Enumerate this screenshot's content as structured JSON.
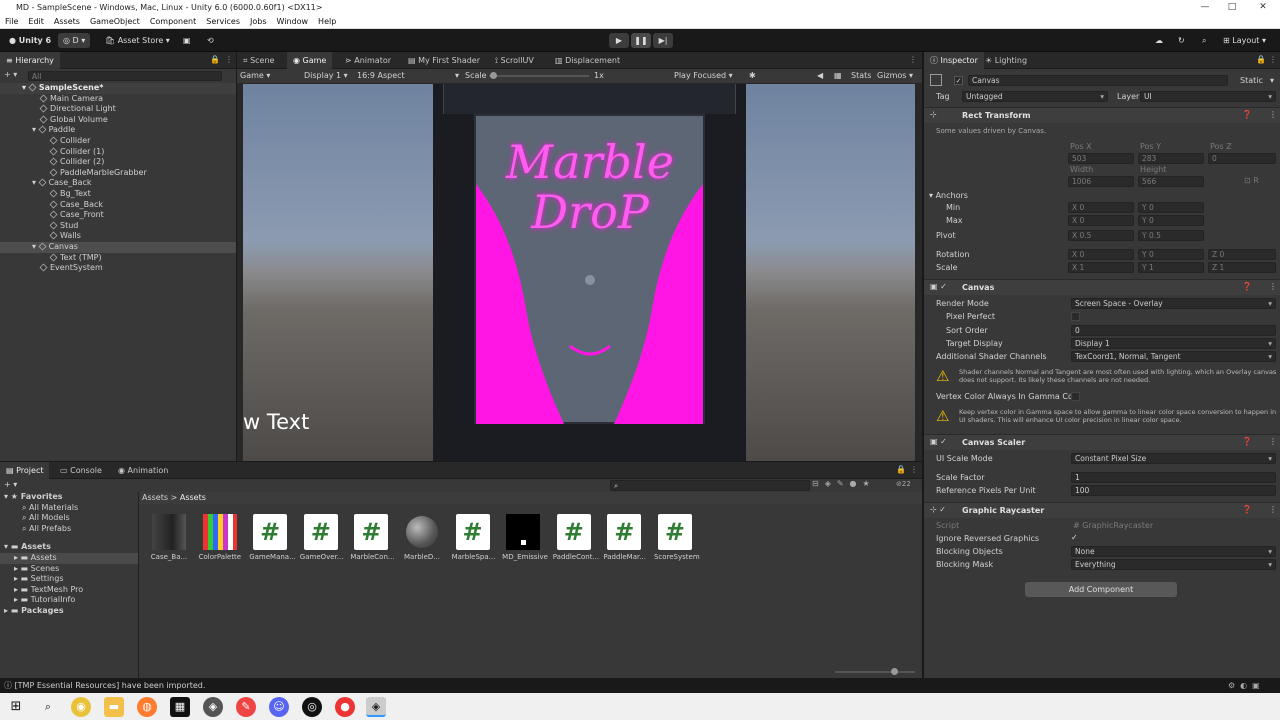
{
  "window": {
    "title": "MD - SampleScene - Windows, Mac, Linux - Unity 6.0 (6000.0.60f1) <DX11>"
  },
  "menu": [
    "File",
    "Edit",
    "Assets",
    "GameObject",
    "Component",
    "Services",
    "Jobs",
    "Window",
    "Help"
  ],
  "toolbar": {
    "account": "Unity 6",
    "collab": "D",
    "asset_store": "Asset Store",
    "layout": "Layout"
  },
  "scene_tabs": [
    "Scene",
    "Game",
    "Animator",
    "My First Shader",
    "ScrollUV",
    "Displacement"
  ],
  "game_bar": {
    "mode": "Game",
    "display": "Display 1",
    "aspect": "16:9 Aspect",
    "scale_label": "Scale",
    "scale_value": "1x",
    "play_focused": "Play Focused",
    "stats": "Stats",
    "gizmos": "Gizmos"
  },
  "game_view": {
    "sign_line1": "Marble",
    "sign_line2": "DroP",
    "overlay_text": "w Text",
    "accent": "#ff16e4"
  },
  "hierarchy": {
    "tab": "Hierarchy",
    "search_placeholder": "All",
    "items": [
      {
        "label": "SampleScene*"
      },
      {
        "label": "Main Camera"
      },
      {
        "label": "Directional Light"
      },
      {
        "label": "Global Volume"
      },
      {
        "label": "Paddle"
      },
      {
        "label": "Collider"
      },
      {
        "label": "Collider (1)"
      },
      {
        "label": "Collider (2)"
      },
      {
        "label": "PaddleMarbleGrabber"
      },
      {
        "label": "Case_Back"
      },
      {
        "label": "Bg_Text"
      },
      {
        "label": "Case_Back"
      },
      {
        "label": "Case_Front"
      },
      {
        "label": "Stud"
      },
      {
        "label": "Walls"
      },
      {
        "label": "Canvas"
      },
      {
        "label": "Text (TMP)"
      },
      {
        "label": "EventSystem"
      }
    ]
  },
  "inspector": {
    "tabs": [
      "Inspector",
      "Lighting"
    ],
    "object_name": "Canvas",
    "static": "Static",
    "tag_label": "Tag",
    "tag_value": "Untagged",
    "layer_label": "Layer",
    "layer_value": "UI",
    "rect_transform": {
      "title": "Rect Transform",
      "note": "Some values driven by Canvas.",
      "posx_l": "Pos X",
      "posy_l": "Pos Y",
      "posz_l": "Pos Z",
      "posx": "503",
      "posy": "283",
      "posz": "0",
      "width_l": "Width",
      "height_l": "Height",
      "width": "1006",
      "height": "566",
      "anchors": "Anchors",
      "min": "Min",
      "max": "Max",
      "min_x": "0",
      "min_y": "0",
      "max_x": "0",
      "max_y": "0",
      "pivot": "Pivot",
      "pivot_x": "0.5",
      "pivot_y": "0.5",
      "rotation": "Rotation",
      "rot_x": "0",
      "rot_y": "0",
      "rot_z": "0",
      "scale": "Scale",
      "sc_x": "1",
      "sc_y": "1",
      "sc_z": "1"
    },
    "canvas": {
      "title": "Canvas",
      "render_mode_l": "Render Mode",
      "render_mode": "Screen Space - Overlay",
      "pixel_perfect": "Pixel Perfect",
      "sort_order_l": "Sort Order",
      "sort_order": "0",
      "target_display_l": "Target Display",
      "target_display": "Display 1",
      "shader_channels_l": "Additional Shader Channels",
      "shader_channels": "TexCoord1, Normal, Tangent",
      "warning1": "Shader channels Normal and Tangent are most often used with lighting, which an Overlay canvas does not support. Its likely these channels are not needed.",
      "vertex_color": "Vertex Color Always In Gamma Colo",
      "warning2": "Keep vertex color in Gamma space to allow gamma to linear color space conversion to happen in UI shaders. This will enhance UI color precision in linear color space."
    },
    "canvas_scaler": {
      "title": "Canvas Scaler",
      "mode_l": "UI Scale Mode",
      "mode": "Constant Pixel Size",
      "factor_l": "Scale Factor",
      "factor": "1",
      "ref_l": "Reference Pixels Per Unit",
      "ref": "100"
    },
    "raycaster": {
      "title": "Graphic Raycaster",
      "script_l": "Script",
      "script": "GraphicRaycaster",
      "ignore_l": "Ignore Reversed Graphics",
      "blocking_l": "Blocking Objects",
      "blocking": "None",
      "mask_l": "Blocking Mask",
      "mask": "Everything"
    },
    "add_component": "Add Component"
  },
  "project": {
    "tabs": [
      "Project",
      "Console",
      "Animation"
    ],
    "favorites": "Favorites",
    "fav_items": [
      "All Materials",
      "All Models",
      "All Prefabs"
    ],
    "assets_root": "Assets",
    "asset_folders": [
      "Assets",
      "Scenes",
      "Settings",
      "TextMesh Pro",
      "TutorialInfo"
    ],
    "packages": "Packages",
    "breadcrumb": [
      "Assets",
      "Assets"
    ],
    "hidden_count": "22",
    "assets": [
      {
        "name": "Case_Ba...",
        "kind": "model"
      },
      {
        "name": "ColorPalette",
        "kind": "palette"
      },
      {
        "name": "GameMana...",
        "kind": "script"
      },
      {
        "name": "GameOver...",
        "kind": "script"
      },
      {
        "name": "MarbleCon...",
        "kind": "script"
      },
      {
        "name": "MarbleD...",
        "kind": "sphere"
      },
      {
        "name": "MarbleSpa...",
        "kind": "script"
      },
      {
        "name": "MD_Emissive",
        "kind": "black"
      },
      {
        "name": "PaddleCont...",
        "kind": "script"
      },
      {
        "name": "PaddleMar...",
        "kind": "script"
      },
      {
        "name": "ScoreSystem",
        "kind": "script"
      }
    ]
  },
  "status": {
    "message": "[TMP Essential Resources] have been imported."
  }
}
